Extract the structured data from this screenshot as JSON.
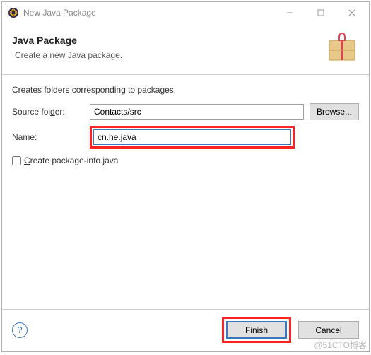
{
  "window": {
    "title": "New Java Package"
  },
  "header": {
    "heading": "Java Package",
    "sub": "Create a new Java package."
  },
  "content": {
    "desc": "Creates folders corresponding to packages.",
    "source_label_pre": "Source fol",
    "source_label_u": "d",
    "source_label_post": "er:",
    "source_value": "Contacts/src",
    "browse": "Browse...",
    "name_label_u": "N",
    "name_label_post": "ame:",
    "name_value": "cn.he.java",
    "chk_pre": "",
    "chk_u": "C",
    "chk_post": "reate package-info.java"
  },
  "footer": {
    "finish": "Finish",
    "cancel": "Cancel"
  },
  "watermark": "@51CTO博客"
}
